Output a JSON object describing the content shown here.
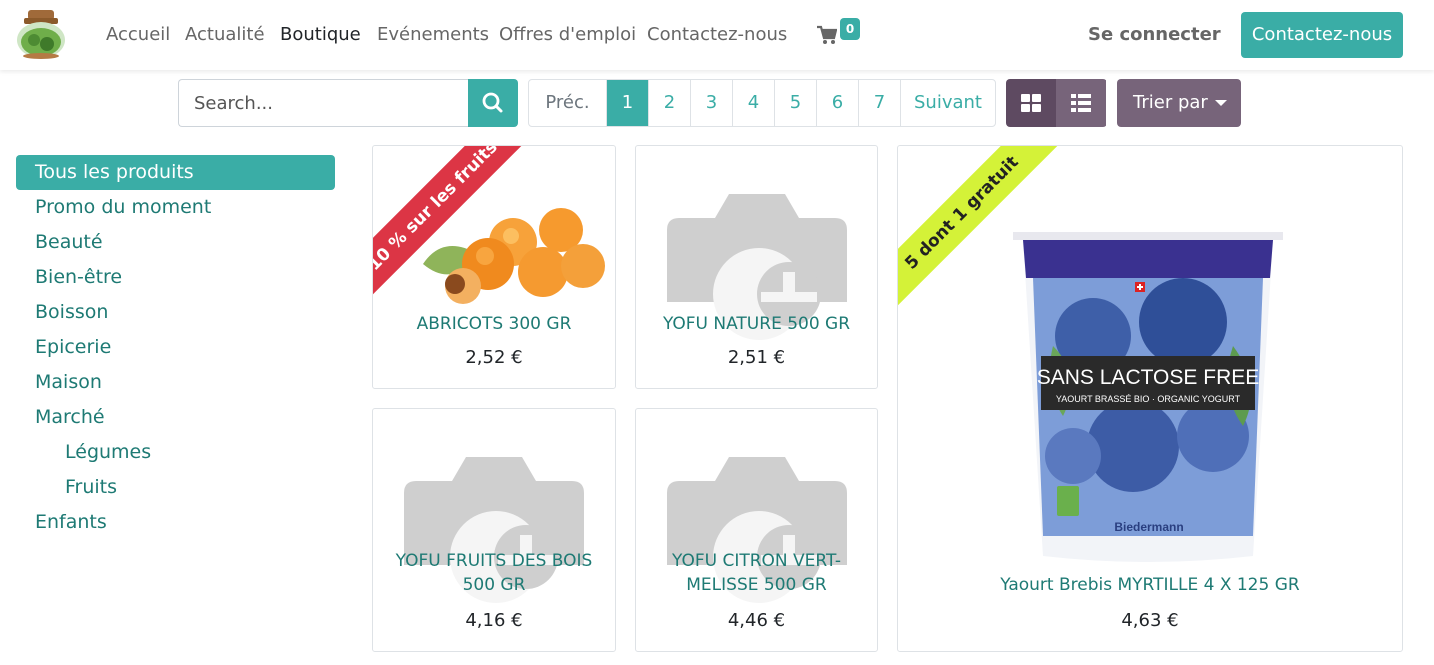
{
  "nav": {
    "links": [
      "Accueil",
      "Actualité",
      "Boutique",
      "Evénements",
      "Offres d'emploi",
      "Contactez-nous"
    ],
    "active_index": 2,
    "cart_count": "0",
    "login_label": "Se connecter",
    "contact_button": "Contactez-nous"
  },
  "toolbar": {
    "search_placeholder": "Search...",
    "pager": {
      "prev": "Préc.",
      "pages": [
        "1",
        "2",
        "3",
        "4",
        "5",
        "6",
        "7"
      ],
      "current": "1",
      "next": "Suivant"
    },
    "sort_label": "Trier par"
  },
  "categories": [
    {
      "label": "Tous les produits",
      "active": true,
      "level": 0
    },
    {
      "label": "Promo du moment",
      "level": 0
    },
    {
      "label": "Beauté",
      "level": 0
    },
    {
      "label": "Bien-être",
      "level": 0
    },
    {
      "label": "Boisson",
      "level": 0
    },
    {
      "label": "Epicerie",
      "level": 0
    },
    {
      "label": "Maison",
      "level": 0
    },
    {
      "label": "Marché",
      "level": 0
    },
    {
      "label": "Légumes",
      "level": 1
    },
    {
      "label": "Fruits",
      "level": 1
    },
    {
      "label": "Enfants",
      "level": 0
    }
  ],
  "products": [
    {
      "name": "ABRICOTS 300 GR",
      "price": "2,52 €",
      "ribbon": "10 % sur les fruits",
      "ribbon_color": "#dc3545",
      "image": "apricots"
    },
    {
      "name": "YOFU NATURE 500 GR",
      "price": "2,51 €",
      "image": "placeholder-camera"
    },
    {
      "name": "Yaourt Brebis MYRTILLE 4 X 125 GR",
      "price": "4,63 €",
      "ribbon": "5 dont 1 gratuit",
      "ribbon_color": "#d4f238",
      "image": "yogurt-cup",
      "cup_text": {
        "brand_line1": "SANS LACTOSE FREE",
        "brand_line2": "YAOURT BRASSÉ BIO · ORGANIC YOGURT",
        "maker": "Biedermann"
      }
    },
    {
      "name": "YOFU FRUITS DES BOIS 500 GR",
      "price": "4,16 €",
      "image": "placeholder-camera"
    },
    {
      "name": "YOFU CITRON VERT-MELISSE 500 GR",
      "price": "4,46 €",
      "image": "placeholder-camera"
    }
  ],
  "colors": {
    "primary": "#3aada6",
    "secondary": "#77647a",
    "link": "#1e7a74"
  }
}
